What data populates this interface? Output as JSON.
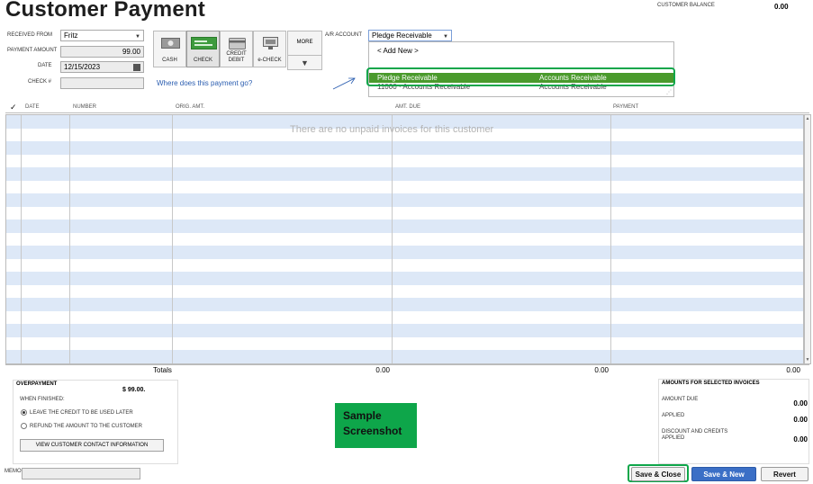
{
  "window": {
    "title": "Customer Payment"
  },
  "balance": {
    "label": "CUSTOMER BALANCE",
    "value": "0.00"
  },
  "form": {
    "received_from_label": "RECEIVED FROM",
    "received_from_value": "Fritz",
    "payment_amount_label": "PAYMENT AMOUNT",
    "payment_amount_value": "99.00",
    "date_label": "DATE",
    "date_value": "12/15/2023",
    "check_label": "CHECK #",
    "check_value": ""
  },
  "methods": [
    {
      "label": "CASH",
      "icon": "cash-icon"
    },
    {
      "label": "CHECK",
      "icon": "check-icon",
      "selected": true
    },
    {
      "label": "CREDIT\nDEBIT",
      "icon": "credit-card-icon"
    },
    {
      "label": "e-CHECK",
      "icon": "echeck-icon"
    },
    {
      "label": "MORE",
      "icon": "chevron-down-icon"
    }
  ],
  "where_link": "Where does this payment go?",
  "ar_account": {
    "label": "A/R ACCOUNT",
    "value": "Pledge Receivable",
    "options": [
      {
        "name": "< Add New >",
        "type": ""
      },
      {
        "name": "Pledge Receivable",
        "type": "Accounts Receivable",
        "highlighted": true
      },
      {
        "name": "11000 · Accounts Receivable",
        "type": "Accounts Receivable"
      }
    ]
  },
  "table": {
    "columns": [
      "✓",
      "DATE",
      "NUMBER",
      "ORIG. AMT.",
      "AMT. DUE",
      "PAYMENT"
    ],
    "empty_message": "There are no unpaid invoices for this customer",
    "totals_label": "Totals",
    "totals_orig": "0.00",
    "totals_due": "0.00",
    "totals_payment": "0.00"
  },
  "overpayment": {
    "title": "OVERPAYMENT",
    "amount": "$ 99.00.",
    "when_finished": "WHEN FINISHED:",
    "option_leave": "LEAVE THE CREDIT TO BE USED LATER",
    "option_refund": "REFUND THE AMOUNT TO THE CUSTOMER",
    "contact_button": "VIEW CUSTOMER CONTACT INFORMATION"
  },
  "sample_note": {
    "line1": "Sample",
    "line2": "Screenshot"
  },
  "amounts": {
    "title": "AMOUNTS FOR SELECTED INVOICES",
    "amount_due_label": "AMOUNT DUE",
    "amount_due_value": "0.00",
    "applied_label": "APPLIED",
    "applied_value": "0.00",
    "discount_label_1": "DISCOUNT AND CREDITS",
    "discount_label_2": "APPLIED",
    "discount_value": "0.00"
  },
  "memo": {
    "label": "MEMO",
    "value": ""
  },
  "buttons": {
    "save_close": "Save & Close",
    "save_new": "Save & New",
    "revert": "Revert"
  },
  "colors": {
    "highlight_green": "#4a9a2c",
    "callout_green": "#0ea64a",
    "stripe_blue": "#dde8f7",
    "link_blue": "#2a5db0",
    "save_new_blue": "#3b6fc6"
  }
}
